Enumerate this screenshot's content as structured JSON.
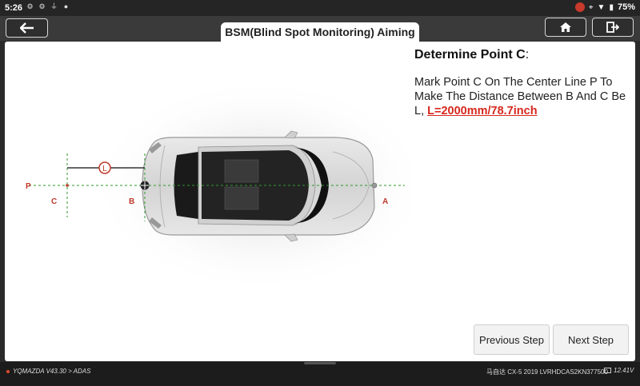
{
  "status_bar": {
    "time": "5:26",
    "battery": "75%"
  },
  "header": {
    "title": "BSM(Blind Spot Monitoring) Aiming",
    "icons": [
      "back-arrow-icon",
      "home-icon",
      "exit-icon"
    ]
  },
  "diagram": {
    "labels": {
      "p": "P",
      "c": "C",
      "b": "B",
      "a": "A",
      "l": "L"
    },
    "colors": {
      "guide": "#2f9a2f",
      "marker": "#c0392b"
    }
  },
  "instruction": {
    "title": "Determine Point C",
    "title_suffix": ":",
    "body": "Mark Point C On The Center Line P To Make The Distance Between B And C Be L, ",
    "highlight": "L=2000mm/78.7inch",
    "highlight_color": "#d6281e"
  },
  "buttons": {
    "previous": "Previous Step",
    "next": "Next Step"
  },
  "footer": {
    "path": "YQMAZDA V43.30 > ADAS",
    "vehicle": "马自达 CX-5 2019  LVRHDCAS2KN377500",
    "voltage": "12.41V"
  }
}
